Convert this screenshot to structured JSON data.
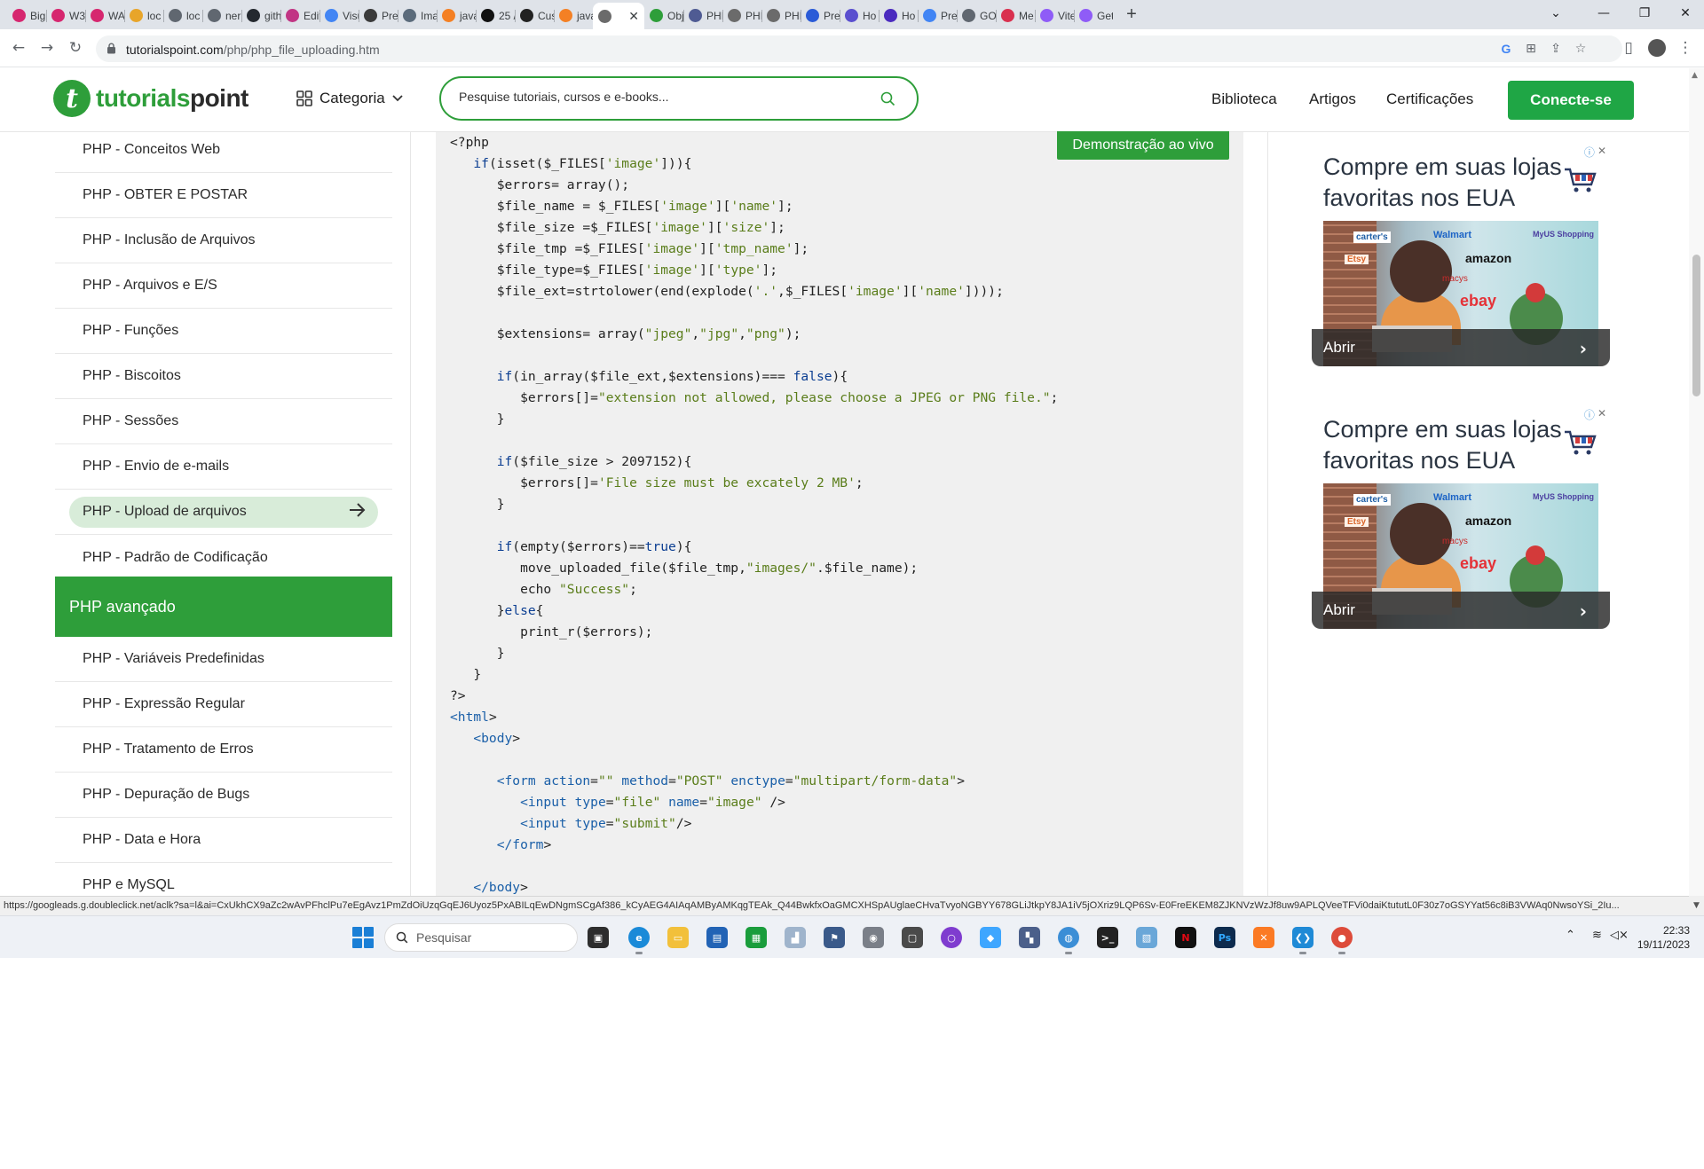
{
  "browser": {
    "tabs": [
      {
        "title": "Big",
        "icon": "instagram-icon",
        "color": "#d6276f"
      },
      {
        "title": "W3",
        "icon": "instagram-icon",
        "color": "#d6276f"
      },
      {
        "title": "WA",
        "icon": "instagram-icon",
        "color": "#d6276f"
      },
      {
        "title": "loc",
        "icon": "blog-icon",
        "color": "#e8a52a"
      },
      {
        "title": "loc",
        "icon": "globe-icon",
        "color": "#606770"
      },
      {
        "title": "ner",
        "icon": "globe-icon",
        "color": "#606770"
      },
      {
        "title": "gith",
        "icon": "github-icon",
        "color": "#24292f"
      },
      {
        "title": "Edit",
        "icon": "instagram-icon",
        "color": "#c13584"
      },
      {
        "title": "Visu",
        "icon": "google-icon",
        "color": "#4285f4"
      },
      {
        "title": "Pre",
        "icon": "tm-icon",
        "color": "#3b3b3b"
      },
      {
        "title": "Ima",
        "icon": "docs-icon",
        "color": "#5b6b7b"
      },
      {
        "title": "java",
        "icon": "stackoverflow-icon",
        "color": "#f48024"
      },
      {
        "title": "25 /",
        "icon": "tp-icon",
        "color": "#111111"
      },
      {
        "title": "Cus",
        "icon": "codepen-icon",
        "color": "#222222"
      },
      {
        "title": "java",
        "icon": "stackoverflow-icon",
        "color": "#f48024"
      },
      {
        "title": "",
        "icon": "tutorialspoint-icon",
        "color": "#6b6b6b"
      },
      {
        "title": "Obj",
        "icon": "tutorialspoint-icon",
        "color": "#2e9e3a"
      },
      {
        "title": "PHI",
        "icon": "php-icon",
        "color": "#4f5b93"
      },
      {
        "title": "PHI",
        "icon": "tutorialspoint-icon",
        "color": "#6b6b6b"
      },
      {
        "title": "PHI",
        "icon": "tutorialspoint-icon",
        "color": "#6b6b6b"
      },
      {
        "title": "Pre",
        "icon": "co-icon",
        "color": "#2a5bd7"
      },
      {
        "title": "Ho",
        "icon": "hex-icon",
        "color": "#5a4fcf"
      },
      {
        "title": "Ho",
        "icon": "terminal-icon",
        "color": "#4b2bbf"
      },
      {
        "title": "Pre",
        "icon": "google-icon",
        "color": "#4285f4"
      },
      {
        "title": "GO",
        "icon": "globe-icon",
        "color": "#606770"
      },
      {
        "title": "Me",
        "icon": "mongo-icon",
        "color": "#d9304f"
      },
      {
        "title": "Vite",
        "icon": "vite-icon",
        "color": "#8f5cf7"
      },
      {
        "title": "Get",
        "icon": "vite-icon",
        "color": "#8f5cf7"
      }
    ],
    "active_tab_index": 15,
    "url": "tutorialspoint.com",
    "url_path": "/php/php_file_uploading.htm"
  },
  "site": {
    "logo_left": "tutorials",
    "logo_right": "point",
    "category_label": "Categoria",
    "search_placeholder": "Pesquise tutoriais, cursos e e-books...",
    "nav": [
      "Biblioteca",
      "Artigos",
      "Certificações"
    ],
    "signin_label": "Conecte-se",
    "brand_color": "#2e9e3a"
  },
  "sidebar": {
    "items_top": [
      "PHP - Conceitos Web",
      "PHP - OBTER E POSTAR",
      "PHP - Inclusão de Arquivos",
      "PHP - Arquivos e E/S",
      "PHP - Funções",
      "PHP - Biscoitos",
      "PHP - Sessões",
      "PHP - Envio de e-mails",
      "PHP - Upload de arquivos",
      "PHP - Padrão de Codificação"
    ],
    "active_item": "PHP - Upload de arquivos",
    "section_title": "PHP avançado",
    "items_bottom": [
      "PHP - Variáveis Predefinidas",
      "PHP - Expressão Regular",
      "PHP - Tratamento de Erros",
      "PHP - Depuração de Bugs",
      "PHP - Data e Hora",
      "PHP e MySQL"
    ]
  },
  "content": {
    "live_demo_label": "Demonstração ao vivo",
    "code_lines": [
      "<?php",
      "   if(isset($_FILES['image'])){",
      "      $errors= array();",
      "      $file_name = $_FILES['image']['name'];",
      "      $file_size =$_FILES['image']['size'];",
      "      $file_tmp =$_FILES['image']['tmp_name'];",
      "      $file_type=$_FILES['image']['type'];",
      "      $file_ext=strtolower(end(explode('.',$_FILES['image']['name'])));",
      "",
      "      $extensions= array(\"jpeg\",\"jpg\",\"png\");",
      "",
      "      if(in_array($file_ext,$extensions)=== false){",
      "         $errors[]=\"extension not allowed, please choose a JPEG or PNG file.\";",
      "      }",
      "",
      "      if($file_size > 2097152){",
      "         $errors[]='File size must be excately 2 MB';",
      "      }",
      "",
      "      if(empty($errors)==true){",
      "         move_uploaded_file($file_tmp,\"images/\".$file_name);",
      "         echo \"Success\";",
      "      }else{",
      "         print_r($errors);",
      "      }",
      "   }",
      "?>",
      "<html>",
      "   <body>",
      "",
      "      <form action=\"\" method=\"POST\" enctype=\"multipart/form-data\">",
      "         <input type=\"file\" name=\"image\" />",
      "         <input type=\"submit\"/>",
      "      </form>",
      "",
      "   </body>"
    ]
  },
  "ads": [
    {
      "title": "Compre em suas lojas favoritas nos EUA",
      "cta": "Abrir",
      "brands": [
        "carter's",
        "Walmart",
        "MyUS Shopping",
        "Etsy",
        "amazon",
        "macys",
        "ebay"
      ]
    },
    {
      "title": "Compre em suas lojas favoritas nos EUA",
      "cta": "Abrir",
      "brands": [
        "carter's",
        "Walmart",
        "MyUS Shopping",
        "Etsy",
        "amazon",
        "macys",
        "ebay"
      ]
    }
  ],
  "status_url": "https://googleads.g.doubleclick.net/aclk?sa=l&ai=CxUkhCX9aZc2wAvPFhclPu7eEgAvz1PmZdOiUzqGqEJ6Uyoz5PxABILqEwDNgmSCgAf386_kCyAEG4AIAqAMByAMKqgTEAk_Q44BwkfxOaGMCXHSpAUglaeCHvaTvyoNGBYY678GLiJtkpY8JA1iV5jOXriz9LQP6Sv-E0FreEKEM8ZJKNVzWzJf8uw9APLQVeeTFVi0daiKtututL0F30z7oGSYYat56c8iB3VWAq0NwsoYSi_2Iu...",
  "taskbar": {
    "search_label": "Pesquisar",
    "time": "22:33",
    "date": "19/11/2023"
  }
}
